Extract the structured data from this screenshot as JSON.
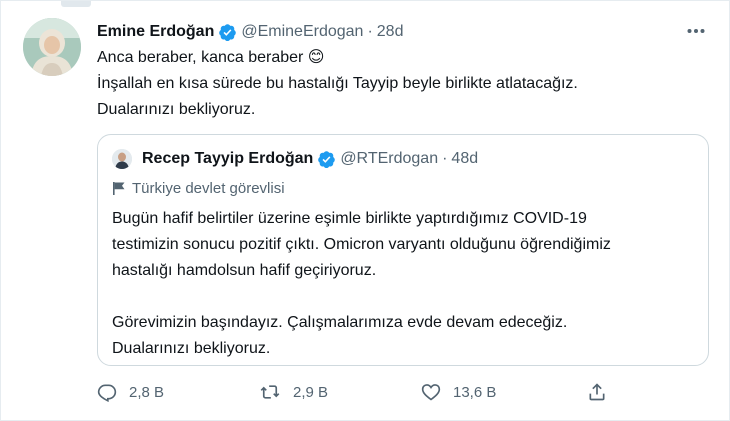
{
  "tweet": {
    "author_name": "Emine Erdoğan",
    "handle": "@EmineErdogan",
    "separator": "·",
    "time": "28d",
    "text_lines": [
      "Anca beraber, kanca beraber 😊",
      "İnşallah en kısa sürede bu hastalığı Tayyip beyle birlikte atlatacağız.",
      "Dualarınızı bekliyoruz."
    ],
    "more_icon": "more-horizontal-icon",
    "verified_icon": "verified-badge-icon",
    "verified_color": "#1d9bf0"
  },
  "quoted_tweet": {
    "author_name": "Recep Tayyip Erdoğan",
    "handle": "@RTErdogan",
    "separator": "·",
    "time": "48d",
    "label": "Türkiye devlet görevlisi",
    "label_icon": "flag-icon",
    "text_lines": [
      "Bugün hafif belirtiler üzerine eşimle birlikte yaptırdığımız COVID-19",
      "testimizin sonucu pozitif çıktı. Omicron varyantı olduğunu öğrendiğimiz",
      "hastalığı hamdolsun hafif geçiriyoruz.",
      "",
      "Görevimizin başındayız. Çalışmalarımıza evde devam edeceğiz.",
      "Dualarınızı bekliyoruz."
    ]
  },
  "actions": {
    "reply_count": "2,8 B",
    "retweet_count": "2,9 B",
    "like_count": "13,6 B",
    "reply_icon": "reply-icon",
    "retweet_icon": "retweet-icon",
    "like_icon": "heart-icon",
    "share_icon": "share-icon"
  },
  "colors": {
    "text": "#0f1419",
    "muted": "#536471",
    "border": "#cfd9de",
    "accent": "#1d9bf0"
  }
}
